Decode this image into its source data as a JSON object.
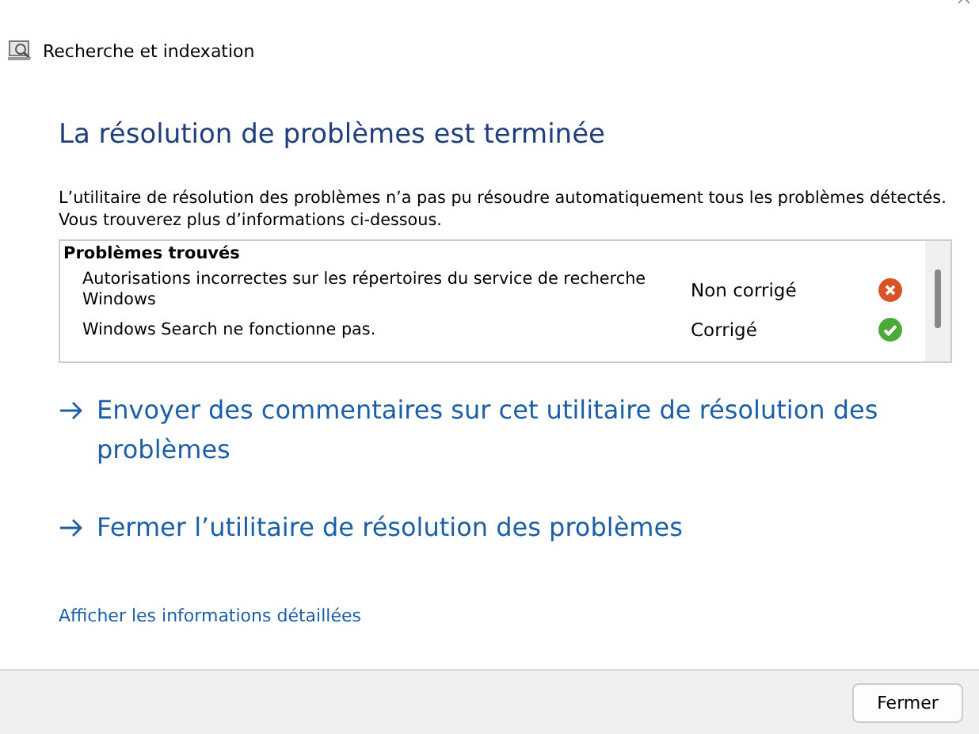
{
  "window": {
    "title": "Recherche et indexation"
  },
  "heading": "La résolution de problèmes est terminée",
  "message": "L’utilitaire de résolution des problèmes n’a pas pu résoudre automatiquement tous les problèmes détectés. Vous trouverez plus d’informations ci-dessous.",
  "problems": {
    "title": "Problèmes trouvés",
    "rows": [
      {
        "name": "Autorisations incorrectes sur les répertoires du service de recherche Windows",
        "status": "Non corrigé",
        "fixed": false
      },
      {
        "name": "Windows Search ne fonctionne pas.",
        "status": "Corrigé",
        "fixed": true
      }
    ]
  },
  "actions": [
    "Envoyer des commentaires sur cet utilitaire de résolution des problèmes",
    "Fermer l’utilitaire de résolution des problèmes"
  ],
  "details_link": "Afficher les informations détaillées",
  "buttons": [
    "Fermer"
  ]
}
